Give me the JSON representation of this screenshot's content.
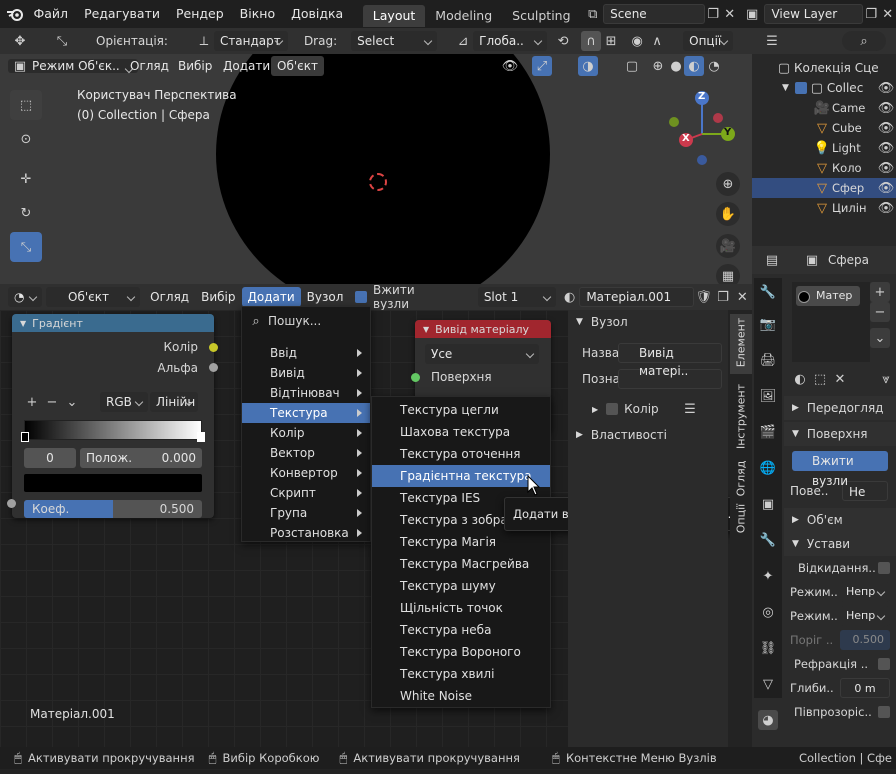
{
  "menubar": {
    "items": [
      "Файл",
      "Редагувати",
      "Рендер",
      "Вікно",
      "Довідка"
    ],
    "workspaces": [
      "Layout",
      "Modeling",
      "Sculpting"
    ],
    "scene": "Scene",
    "view_layer": "View Layer"
  },
  "viewport_header": {
    "orientation_label": "Орієнтація:",
    "orientation_value": "Стандарт",
    "drag_label": "Drag:",
    "drag_value": "Select Box",
    "transform_value": "Глоба..",
    "options": "Опції",
    "mode": "Режим Об'єк..",
    "menus": [
      "Огляд",
      "Вибір",
      "Додати",
      "Об'єкт"
    ]
  },
  "viewport": {
    "view_name": "Користувач Перспектива",
    "collection_info": "(0) Collection | Сфера",
    "gizmo": {
      "z": "Z",
      "y": "Y",
      "x": "X"
    }
  },
  "outliner": {
    "collection": "Колекція Сце",
    "sub_collection": "Collec",
    "items": [
      "Came",
      "Cube",
      "Light",
      "Коло",
      "Сфер",
      "Цилін"
    ]
  },
  "properties": {
    "object_name": "Сфера",
    "material_slot": "Матер",
    "sections": {
      "preview": "Передогляд",
      "surface": "Поверхня",
      "use_nodes": "Вжити вузли",
      "surface_label": "Пове..",
      "surface_value": "Не",
      "volume": "Об'єм",
      "settings": "Устави",
      "backface": "Відкидання..",
      "blend_mode_label": "Режим..",
      "blend_mode_value": "Непр",
      "shadow_mode_label": "Режим..",
      "shadow_mode_value": "Непр",
      "clip_label": "Поріг ..",
      "clip_value": "0.500",
      "refraction": "Рефракція ..",
      "depth_label": "Глиби..",
      "depth_value": "0 m",
      "translucency": "Півпрозоріс.."
    }
  },
  "node_header": {
    "type": "Об'єкт",
    "menus": [
      "Огляд",
      "Вибір",
      "Додати",
      "Вузол"
    ],
    "use_nodes": "Вжити вузли",
    "slot": "Slot 1",
    "material": "Матеріал.001"
  },
  "gradient_node": {
    "title": "Градієнт",
    "out_color": "Колір",
    "out_alpha": "Альфа",
    "mode": "RGB",
    "interp": "Лінійн",
    "index": "0",
    "pos_label": "Полож.",
    "pos_value": "0.000",
    "fac_label": "Коеф.",
    "fac_value": "0.500",
    "fac": 0.5
  },
  "output_node": {
    "title": "Вивід матеріалу",
    "target": "Усе",
    "surface": "Поверхня"
  },
  "material_label": "Матеріал.001",
  "add_menu": {
    "search": "Пошук...",
    "items": [
      "Ввід",
      "Вивід",
      "Відтінювач",
      "Текстура",
      "Колір",
      "Вектор",
      "Конвертор",
      "Скрипт",
      "Група",
      "Розстановка"
    ]
  },
  "texture_menu": {
    "items": [
      "Текстура цегли",
      "Шахова текстура",
      "Текстура оточення",
      "Градієнтна текстура",
      "Текстура IES",
      "Текстура з зображ",
      "Текстура Магія",
      "Текстура Масгрейва",
      "Текстура шуму",
      "Щільність точок",
      "Текстура неба",
      "Текстура Вороного",
      "Текстура хвилі",
      "White Noise"
    ]
  },
  "tooltip": "Додати вузол до активного дерева.",
  "sidebar": {
    "panel": "Вузол",
    "name_label": "Назва",
    "name_value": "Вивід матері..",
    "label_label": "Позна",
    "color": "Колір",
    "properties": "Властивості",
    "tabs": [
      "Елемент",
      "Інструмент",
      "Огляд",
      "Опції"
    ]
  },
  "statusbar": {
    "items": [
      "Активувати прокручування",
      "Вибір Коробкою",
      "Активувати прокручування",
      "Контекстне Меню Вузлів"
    ],
    "right": "Collection | Сфе"
  },
  "colors": {
    "accent": "#4772b3",
    "output_header": "#a1262e",
    "gradient_header": "#3a6b8f",
    "yellow_socket": "#c7c729",
    "gray_socket": "#a1a1a1",
    "green_socket": "#63c763"
  }
}
